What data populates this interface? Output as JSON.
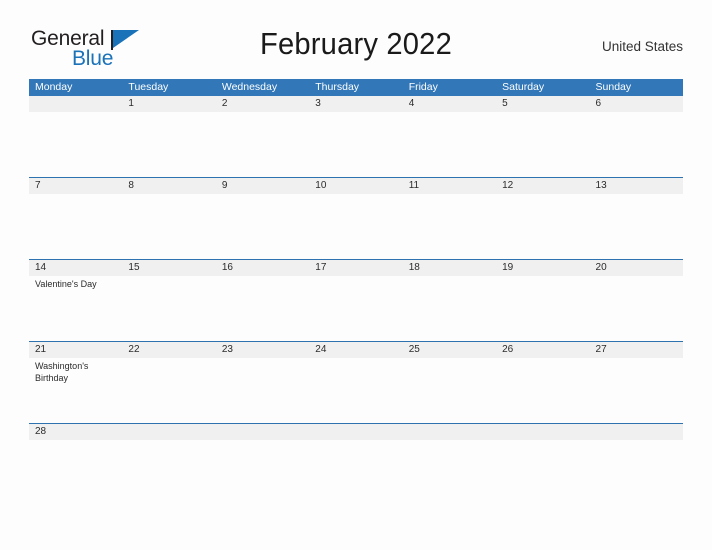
{
  "branding": {
    "logo_word_1": "General",
    "logo_word_2": "Blue",
    "logo_accent_color": "#1a72b8",
    "flag_icon": "flag-triangle-icon"
  },
  "header": {
    "title": "February 2022",
    "region": "United States"
  },
  "theme": {
    "header_row_color": "#3277b8",
    "date_band_color": "#f0f0f0",
    "week_divider_color": "#2f72b0",
    "page_background": "#fdfdfd",
    "text_color": "#2b2b2b"
  },
  "calendar": {
    "month": "February",
    "year": "2022",
    "weekday_headers": [
      "Monday",
      "Tuesday",
      "Wednesday",
      "Thursday",
      "Friday",
      "Saturday",
      "Sunday"
    ],
    "weeks": [
      {
        "height": "tall",
        "days": [
          {
            "num": "",
            "events": []
          },
          {
            "num": "1",
            "events": []
          },
          {
            "num": "2",
            "events": []
          },
          {
            "num": "3",
            "events": []
          },
          {
            "num": "4",
            "events": []
          },
          {
            "num": "5",
            "events": []
          },
          {
            "num": "6",
            "events": []
          }
        ]
      },
      {
        "height": "tall",
        "days": [
          {
            "num": "7",
            "events": []
          },
          {
            "num": "8",
            "events": []
          },
          {
            "num": "9",
            "events": []
          },
          {
            "num": "10",
            "events": []
          },
          {
            "num": "11",
            "events": []
          },
          {
            "num": "12",
            "events": []
          },
          {
            "num": "13",
            "events": []
          }
        ]
      },
      {
        "height": "tall",
        "days": [
          {
            "num": "14",
            "events": [
              "Valentine's Day"
            ]
          },
          {
            "num": "15",
            "events": []
          },
          {
            "num": "16",
            "events": []
          },
          {
            "num": "17",
            "events": []
          },
          {
            "num": "18",
            "events": []
          },
          {
            "num": "19",
            "events": []
          },
          {
            "num": "20",
            "events": []
          }
        ]
      },
      {
        "height": "tall",
        "days": [
          {
            "num": "21",
            "events": [
              "Washington's Birthday"
            ]
          },
          {
            "num": "22",
            "events": []
          },
          {
            "num": "23",
            "events": []
          },
          {
            "num": "24",
            "events": []
          },
          {
            "num": "25",
            "events": []
          },
          {
            "num": "26",
            "events": []
          },
          {
            "num": "27",
            "events": []
          }
        ]
      },
      {
        "height": "short",
        "days": [
          {
            "num": "28",
            "events": []
          },
          {
            "num": "",
            "events": []
          },
          {
            "num": "",
            "events": []
          },
          {
            "num": "",
            "events": []
          },
          {
            "num": "",
            "events": []
          },
          {
            "num": "",
            "events": []
          },
          {
            "num": "",
            "events": []
          }
        ]
      }
    ]
  }
}
